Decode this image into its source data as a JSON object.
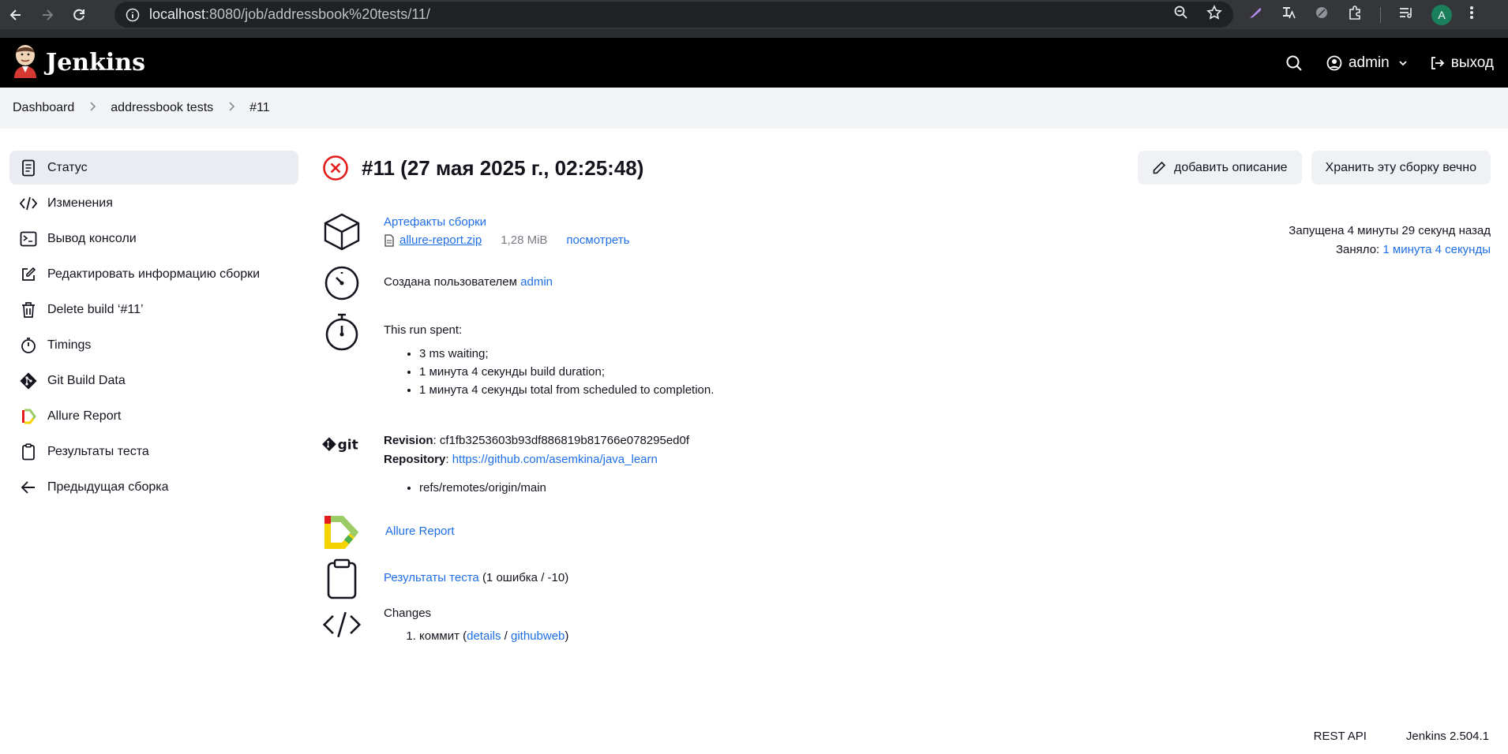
{
  "browser": {
    "url_host": "localhost",
    "url_rest": ":8080/job/addressbook%20tests/11/",
    "profile_initial": "A"
  },
  "header": {
    "brand": "Jenkins",
    "user": "admin",
    "logout": "выход"
  },
  "breadcrumb": [
    "Dashboard",
    "addressbook tests",
    "#11"
  ],
  "sidebar": {
    "items": [
      {
        "label": "Статус",
        "icon": "document-icon"
      },
      {
        "label": "Изменения",
        "icon": "code-icon"
      },
      {
        "label": "Вывод консоли",
        "icon": "terminal-icon"
      },
      {
        "label": "Редактировать информацию сборки",
        "icon": "edit-icon"
      },
      {
        "label": "Delete build ‘#11’",
        "icon": "trash-icon"
      },
      {
        "label": "Timings",
        "icon": "stopwatch-icon"
      },
      {
        "label": "Git Build Data",
        "icon": "git-icon"
      },
      {
        "label": "Allure Report",
        "icon": "allure-icon"
      },
      {
        "label": "Результаты теста",
        "icon": "clipboard-icon"
      },
      {
        "label": "Предыдущая сборка",
        "icon": "arrow-left-icon"
      }
    ]
  },
  "build": {
    "title": "#11 (27 мая 2025 г., 02:25:48)",
    "add_description": "добавить описание",
    "keep_forever": "Хранить эту сборку вечно",
    "started": "Запущена 4 минуты 29 секунд назад",
    "took_label": "Заняло:",
    "took_value": "1 минута 4 секунды"
  },
  "artifacts": {
    "heading": "Артефакты сборки",
    "file": "allure-report.zip",
    "size": "1,28 MiB",
    "view": "посмотреть"
  },
  "cause": {
    "text": "Создана пользователем",
    "user": "admin"
  },
  "timings": {
    "heading": "This run spent:",
    "items": [
      "3 ms waiting;",
      "1 минута 4 секунды build duration;",
      "1 минута 4 секунды total from scheduled to completion."
    ]
  },
  "git": {
    "revision_label": "Revision",
    "revision": "cf1fb3253603b93df886819b81766e078295ed0f",
    "repository_label": "Repository",
    "repository": "https://github.com/asemkina/java_learn",
    "branch": "refs/remotes/origin/main"
  },
  "allure": {
    "label": "Allure Report"
  },
  "tests": {
    "link": "Результаты теста",
    "summary": "(1 ошибка / -10)"
  },
  "changes": {
    "heading": "Changes",
    "item_prefix": "коммит (",
    "details": "details",
    "slash": "/",
    "githubweb": "githubweb",
    "suffix": ")"
  },
  "footer": {
    "rest_api": "REST API",
    "version": "Jenkins 2.504.1"
  },
  "colors": {
    "failed": "#e41b1b",
    "link": "#1e6ee6",
    "header_bg": "#000000"
  }
}
